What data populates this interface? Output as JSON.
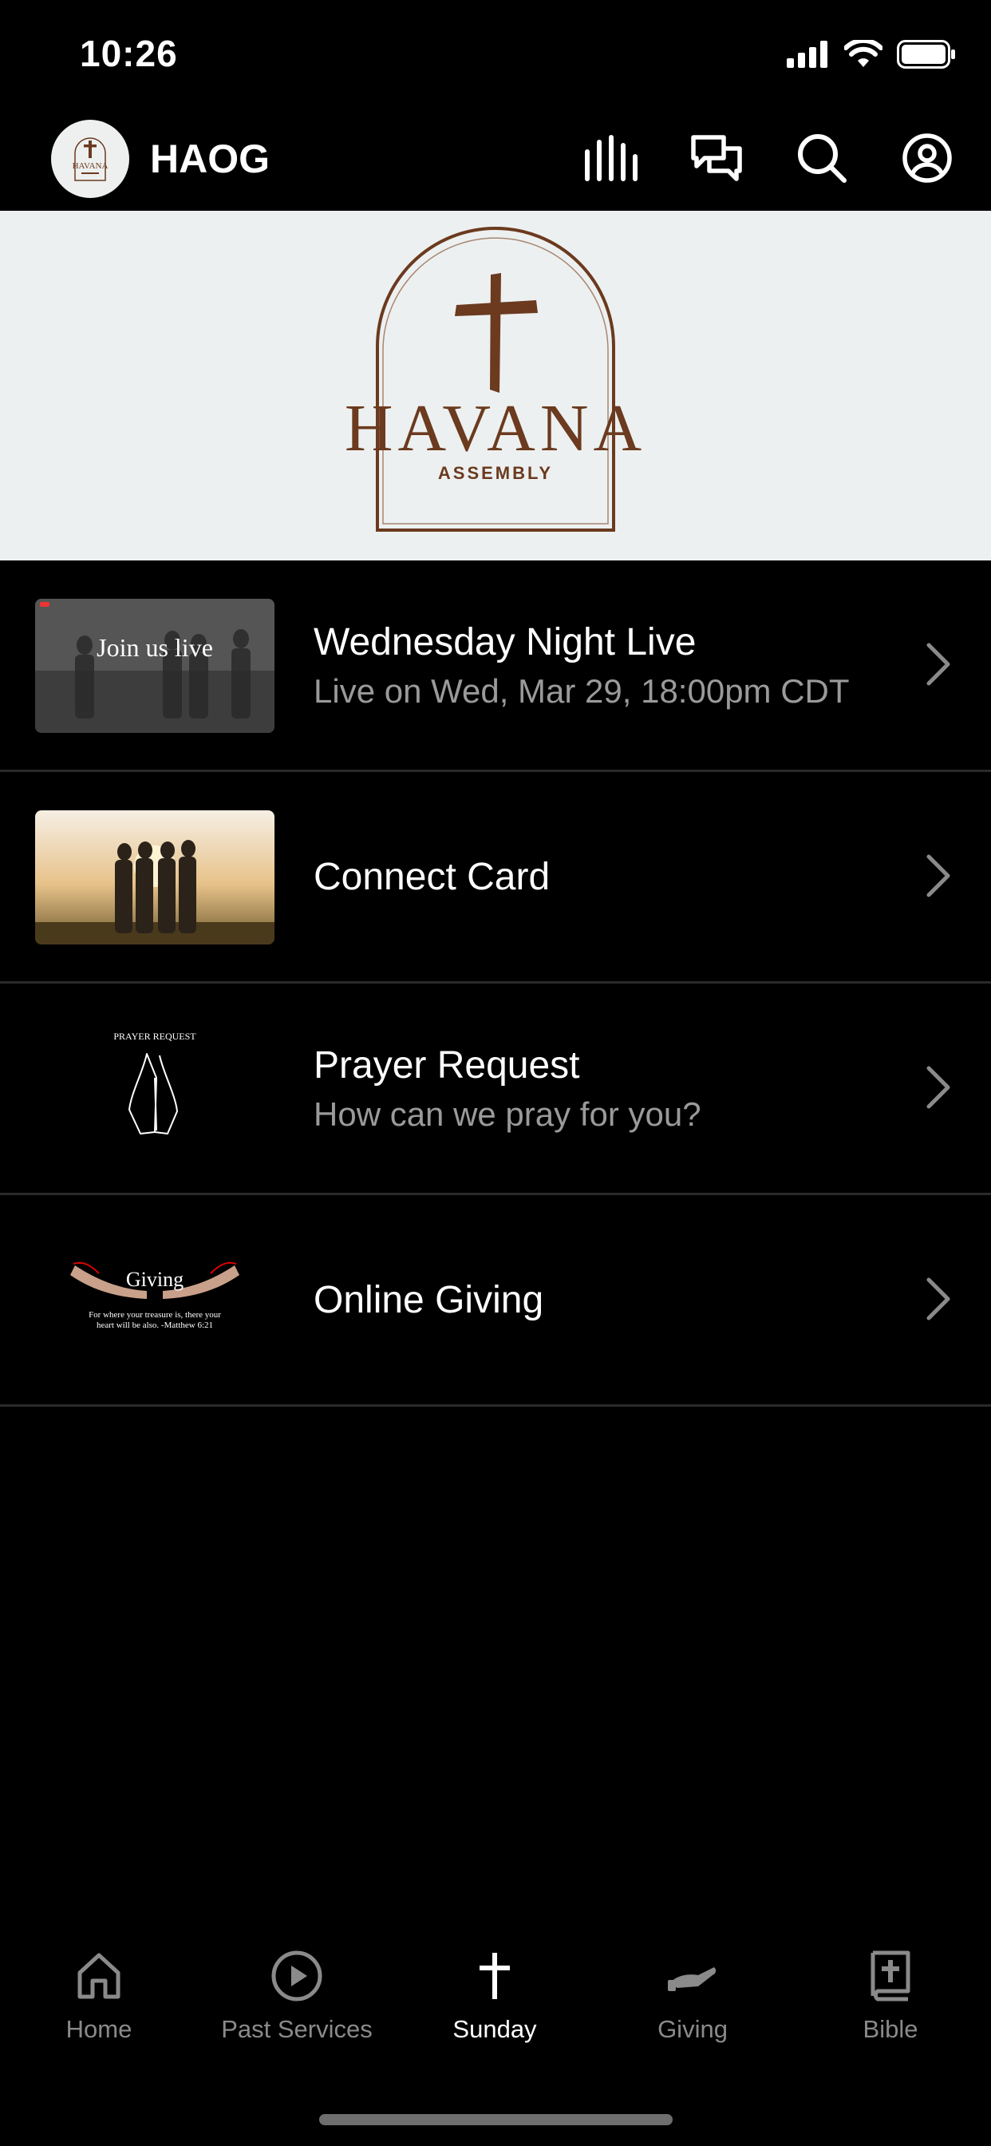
{
  "status_bar": {
    "time": "10:26"
  },
  "header": {
    "title": "HAOG",
    "icons": [
      "audio-bars-icon",
      "chat-icon",
      "search-icon",
      "account-icon"
    ]
  },
  "hero": {
    "brand_name": "HAVANA",
    "brand_sub": "ASSEMBLY"
  },
  "rows": [
    {
      "title": "Wednesday Night Live",
      "subtitle": "Live on Wed, Mar 29, 18:00pm CDT",
      "thumb_text": "Join us live"
    },
    {
      "title": "Connect Card"
    },
    {
      "title": "Prayer Request",
      "subtitle": "How can we pray for you?",
      "thumb_text": "PRAYER REQUEST"
    },
    {
      "title": "Online Giving",
      "thumb_text": "Giving",
      "thumb_caption": "For where your treasure is, there your heart will be also. -Matthew 6:21"
    }
  ],
  "tabs": [
    {
      "label": "Home",
      "icon": "home-icon"
    },
    {
      "label": "Past Services",
      "icon": "play-circle-icon"
    },
    {
      "label": "Sunday",
      "icon": "cross-icon",
      "active": true
    },
    {
      "label": "Giving",
      "icon": "giving-hand-icon"
    },
    {
      "label": "Bible",
      "icon": "bible-icon"
    }
  ],
  "colors": {
    "accent": "#6b3a1f",
    "background": "#000000",
    "hero_bg": "#edf0f0",
    "muted_text": "#9a9a9a"
  }
}
